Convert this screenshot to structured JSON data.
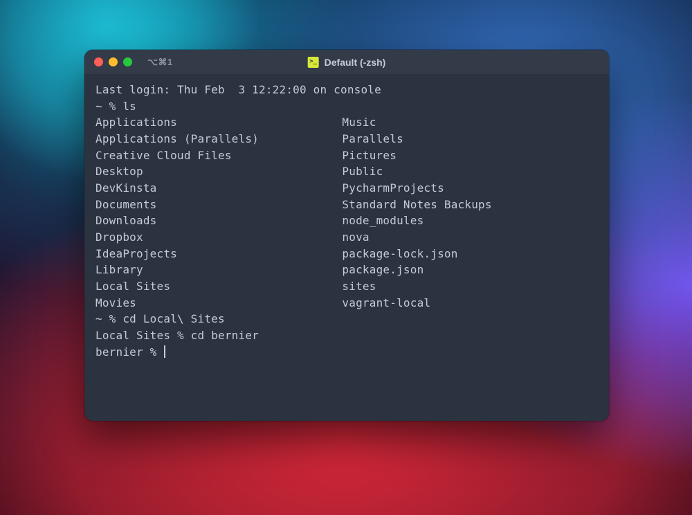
{
  "window": {
    "tab_hint": "⌥⌘1",
    "title": "Default (-zsh)"
  },
  "terminal": {
    "last_login": "Last login: Thu Feb  3 12:22:00 on console",
    "prompt1": "~ % ls",
    "ls": {
      "col1": [
        "Applications",
        "Applications (Parallels)",
        "Creative Cloud Files",
        "Desktop",
        "DevKinsta",
        "Documents",
        "Downloads",
        "Dropbox",
        "IdeaProjects",
        "Library",
        "Local Sites",
        "Movies"
      ],
      "col2": [
        "Music",
        "Parallels",
        "Pictures",
        "Public",
        "PycharmProjects",
        "Standard Notes Backups",
        "node_modules",
        "nova",
        "package-lock.json",
        "package.json",
        "sites",
        "vagrant-local"
      ]
    },
    "prompt2": "~ % cd Local\\ Sites",
    "prompt3": "Local Sites % cd bernier",
    "prompt4": "bernier % "
  }
}
